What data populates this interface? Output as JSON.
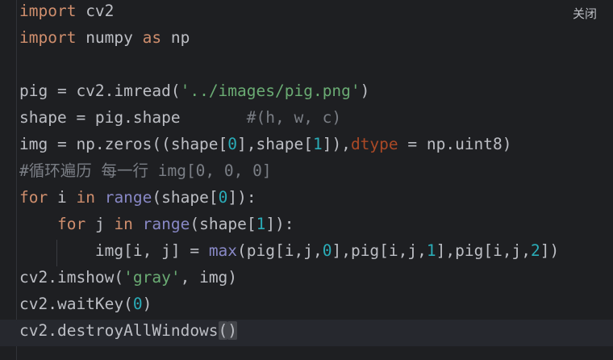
{
  "close_label": "关闭",
  "lines": {
    "l1": {
      "t0": "import",
      "t1": " cv2"
    },
    "l2": {
      "t0": "import",
      "t1": " numpy ",
      "t2": "as",
      "t3": " np"
    },
    "l3": {},
    "l4": {
      "t0": "pig = cv2.imread(",
      "t1": "'../images/pig.png'",
      "t2": ")"
    },
    "l5": {
      "t0": "shape = pig.shape       ",
      "t1": "#(h, w, c)"
    },
    "l6": {
      "t0": "img = np.zeros((shape[",
      "t1": "0",
      "t2": "],shape[",
      "t3": "1",
      "t4": "]),",
      "t5": "dtype",
      "t6": " = np.uint8)"
    },
    "l7": {
      "t0": "#循环遍历 每一行 img[0, 0, 0]"
    },
    "l8": {
      "t0": "for",
      "t1": " i ",
      "t2": "in",
      "t3": " ",
      "t4": "range",
      "t5": "(shape[",
      "t6": "0",
      "t7": "]):"
    },
    "l9": {
      "t0": "    ",
      "t1": "for",
      "t2": " j ",
      "t3": "in",
      "t4": " ",
      "t5": "range",
      "t6": "(shape[",
      "t7": "1",
      "t8": "]):"
    },
    "l10": {
      "t0": "        img[i, j] = ",
      "t1": "max",
      "t2": "(pig[i,j,",
      "t3": "0",
      "t4": "],pig[i,j,",
      "t5": "1",
      "t6": "],pig[i,j,",
      "t7": "2",
      "t8": "])"
    },
    "l11": {
      "t0": "cv2.imshow(",
      "t1": "'gray'",
      "t2": ", img)"
    },
    "l12": {
      "t0": "cv2.waitKey(",
      "t1": "0",
      "t2": ")"
    },
    "l13": {
      "t0": "cv2.destroyAllWindows",
      "t1": "(",
      "t2": ")"
    }
  }
}
